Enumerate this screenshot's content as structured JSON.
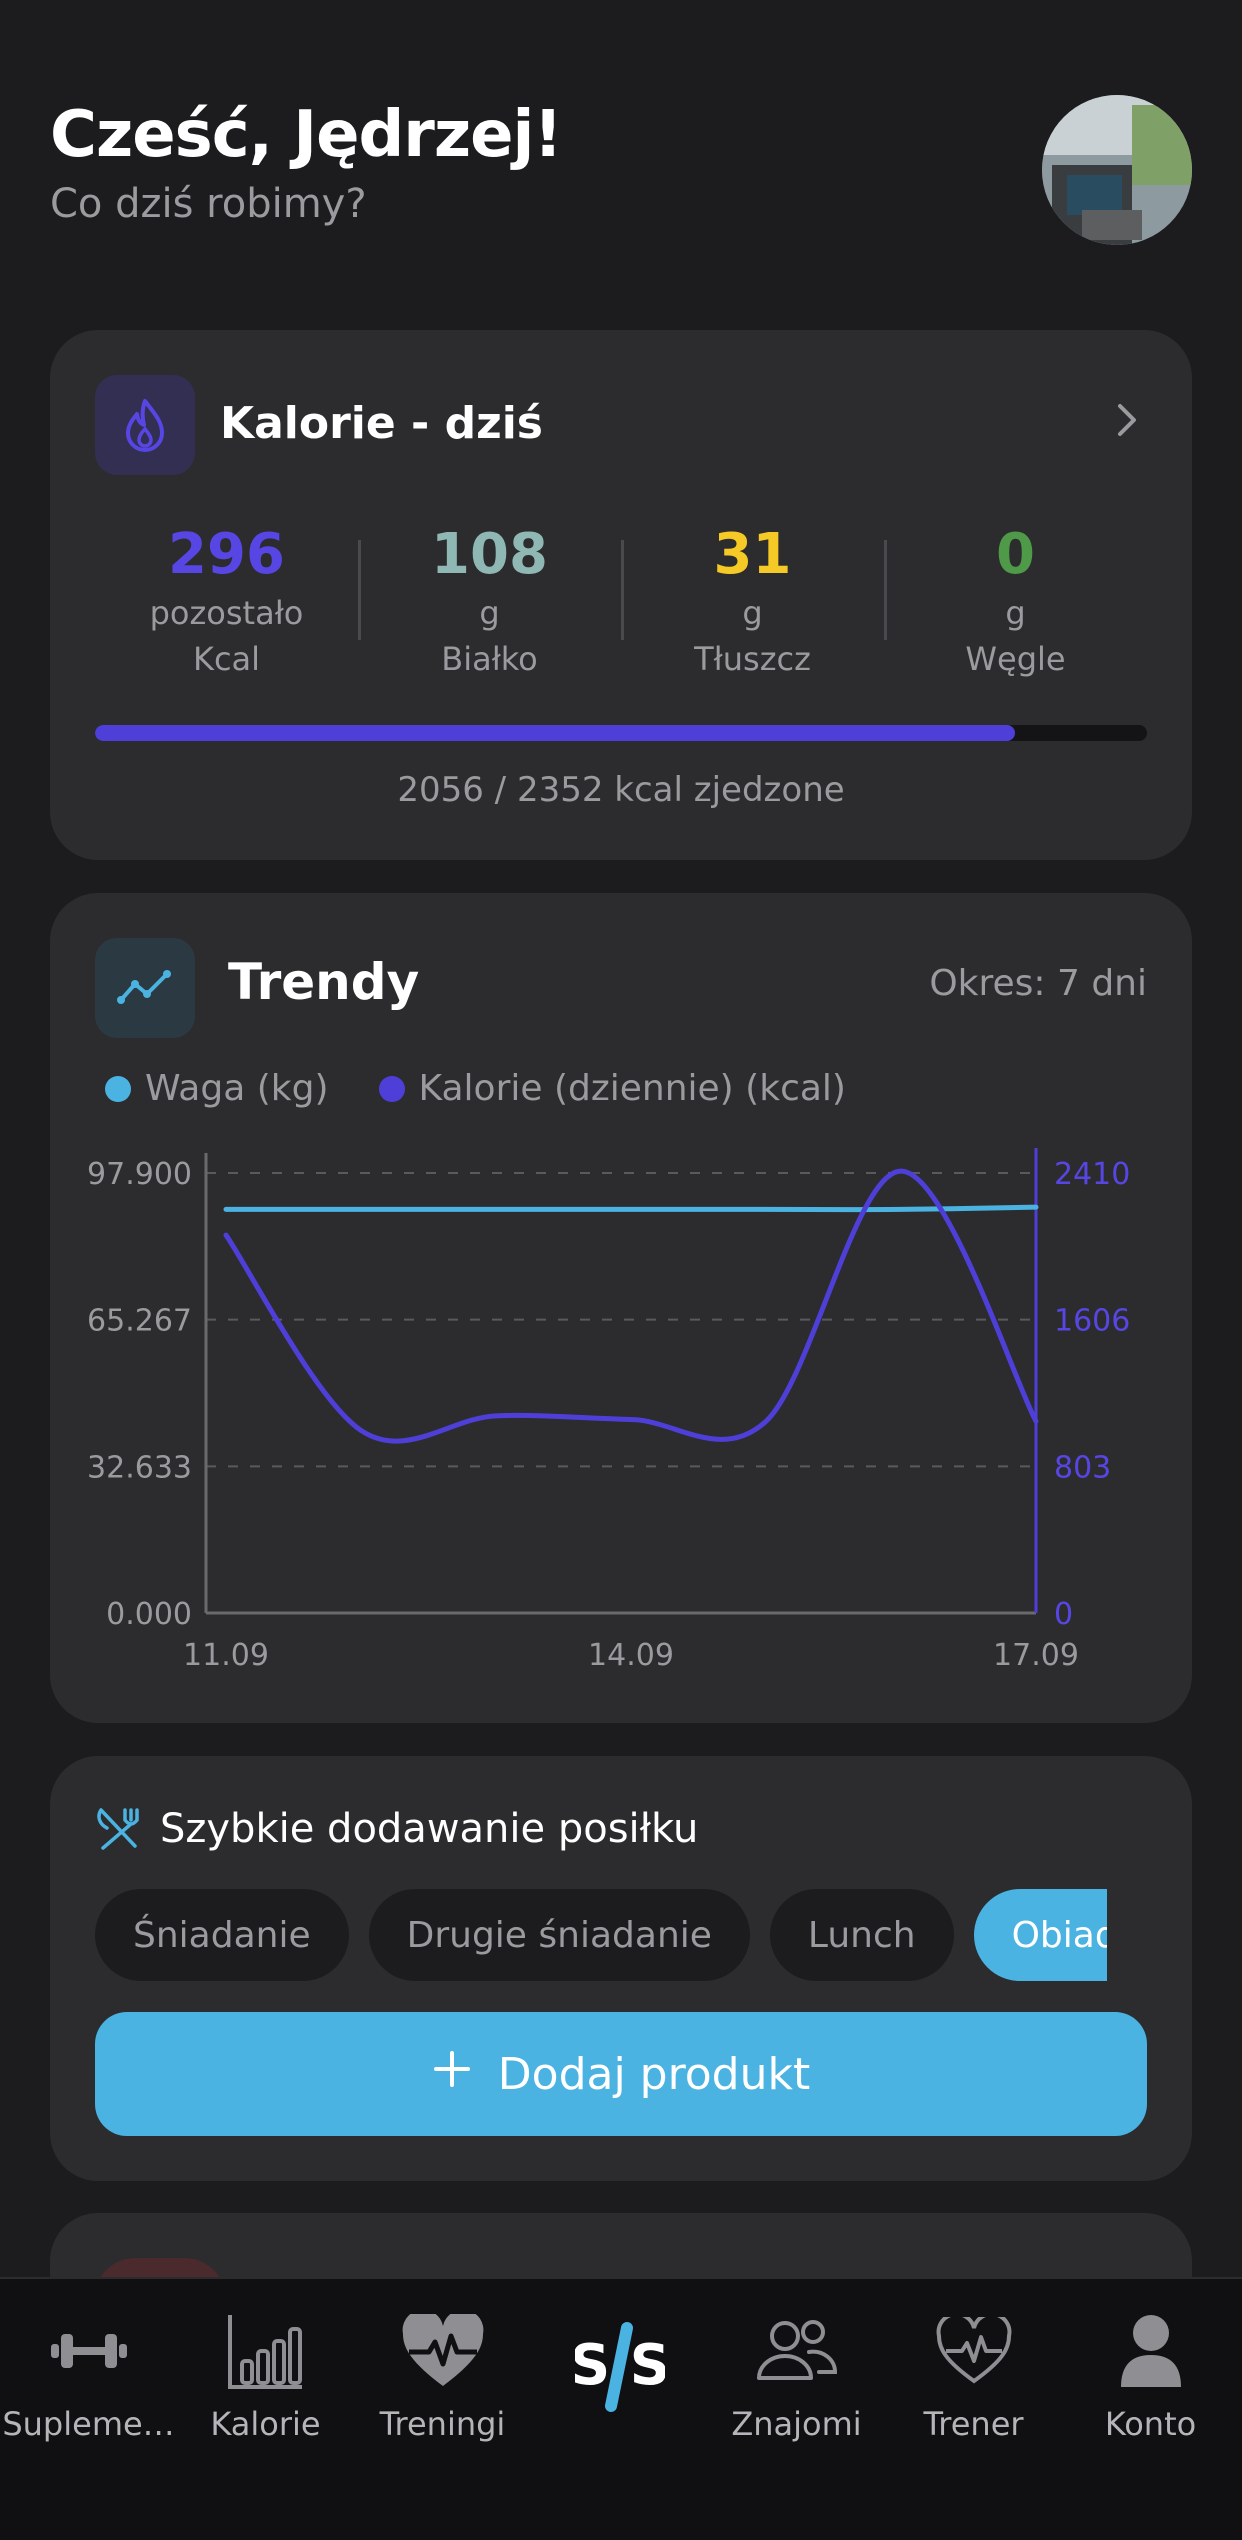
{
  "header": {
    "greeting": "Cześć, Jędrzej!",
    "subtitle": "Co dziś robimy?"
  },
  "calories": {
    "title": "Kalorie - dziś",
    "icon": "flame-icon",
    "macros": [
      {
        "value": "296",
        "unit": "pozostało",
        "name": "Kcal",
        "color": "#5746e3"
      },
      {
        "value": "108",
        "unit": "g",
        "name": "Białko",
        "color": "#8fb7b4"
      },
      {
        "value": "31",
        "unit": "g",
        "name": "Tłuszcz",
        "color": "#f5c926"
      },
      {
        "value": "0",
        "unit": "g",
        "name": "Węgle",
        "color": "#4f9a48"
      }
    ],
    "progress_fraction": 0.8741,
    "progress_text": "2056 / 2352 kcal zjedzone"
  },
  "trends": {
    "title": "Trendy",
    "period": "Okres: 7 dni",
    "legend": [
      {
        "label": "Waga (kg)",
        "color": "#4ab3e2"
      },
      {
        "label": "Kalorie (dziennie) (kcal)",
        "color": "#4f3fd9"
      }
    ]
  },
  "chart_data": {
    "type": "line",
    "x": [
      "11.09",
      "12.09",
      "13.09",
      "14.09",
      "15.09",
      "16.09",
      "17.09"
    ],
    "xticks": [
      "11.09",
      "14.09",
      "17.09"
    ],
    "series": [
      {
        "name": "Waga (kg)",
        "axis": "left",
        "color": "#4ab3e2",
        "values": [
          89.8,
          89.8,
          89.8,
          89.8,
          89.8,
          89.8,
          90.3
        ]
      },
      {
        "name": "Kalorie (dziennie) (kcal)",
        "axis": "right",
        "color": "#4f3fd9",
        "values": [
          2070,
          1000,
          1080,
          1060,
          1050,
          2420,
          1050
        ]
      }
    ],
    "left_ticks": [
      "0.000",
      "32.633",
      "65.267",
      "97.900"
    ],
    "left_ylim": [
      0,
      97.9
    ],
    "right_ticks": [
      "0",
      "803",
      "1606",
      "2410"
    ],
    "right_ylim": [
      0,
      2410
    ],
    "grid": true
  },
  "quick_add": {
    "title": "Szybkie dodawanie posiłku",
    "meals": [
      {
        "label": "Śniadanie",
        "active": false
      },
      {
        "label": "Drugie śniadanie",
        "active": false
      },
      {
        "label": "Lunch",
        "active": false
      },
      {
        "label": "Obiad",
        "active": true
      }
    ],
    "add_label": "Dodaj produkt"
  },
  "nav": {
    "items": [
      {
        "label": "Suplementy",
        "icon": "dumbbell-icon"
      },
      {
        "label": "Kalorie",
        "icon": "bar-chart-icon"
      },
      {
        "label": "Treningi",
        "icon": "heart-pulse-icon"
      },
      {
        "label": "",
        "icon": "logo-icon"
      },
      {
        "label": "Znajomi",
        "icon": "friends-icon"
      },
      {
        "label": "Trener",
        "icon": "heart-outline-icon"
      },
      {
        "label": "Konto",
        "icon": "account-icon"
      }
    ],
    "logo_text": "S/S"
  }
}
